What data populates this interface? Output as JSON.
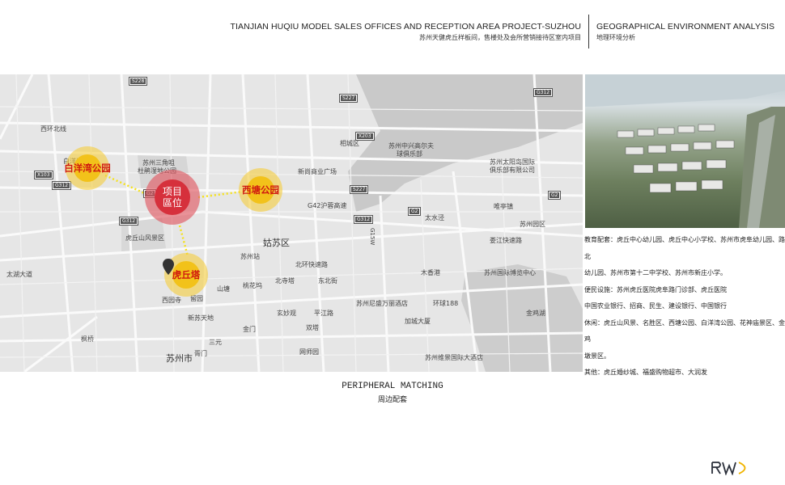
{
  "header": {
    "title_en": "TIANJIAN HUQIU MODEL SALES OFFICES AND RECEPTION AREA PROJECT-SUZHOU",
    "title_cn": "苏州天健虎丘样板间，售楼处及会所营销接待区室内项目",
    "section_en": "GEOGRAPHICAL ENVIRONMENT ANALYSIS",
    "section_cn": "地理环境分析"
  },
  "map": {
    "markers": {
      "project": "项目\n區位",
      "project_line1": "项目",
      "project_line2": "區位",
      "baiyangwan": "白洋湾公园",
      "xitang": "西塘公园",
      "huqiu_tower": "虎丘塔"
    },
    "labels": [
      "苏州三角咀",
      "杜鹃湿地公园",
      "虎丘山风景区",
      "姑苏区",
      "苏州站",
      "苏州中兴高尔夫",
      "球俱乐部",
      "苏州太阳岛国际",
      "俱乐部有限公司",
      "新尚商业广场",
      "G42沪蓉高速",
      "太水泾",
      "唯亭镇",
      "苏州园区",
      "娄江快速路",
      "苏州国际博览中心",
      "苏州尼盛万丽酒店",
      "环球188",
      "加城大厦",
      "苏州维景国际大酒店",
      "双塔",
      "平江路",
      "北寺塔",
      "网师园",
      "苏州市",
      "留园",
      "西园寺",
      "新苏天地",
      "北环快速路",
      "东北街",
      "木香港",
      "金鸡湖",
      "相城区",
      "山塘",
      "桃花坞",
      "西环北线",
      "太湖大道",
      "枫桥",
      "白洋湾",
      "玄妙观",
      "金门",
      "三元",
      "胥门"
    ],
    "shields": [
      "S228",
      "S227",
      "G312",
      "X203",
      "G2",
      "G312",
      "S227",
      "G312",
      "X103",
      "G312",
      "G2",
      "G2",
      "G15W"
    ],
    "connector_color": "#f5e11a",
    "marker_colors": {
      "project": "#d6303c",
      "park": "#f2c21a",
      "label_red": "#d01a10"
    }
  },
  "info": {
    "lines": [
      "教育配套：虎丘中心幼儿园、虎丘中心小学校、苏州市虎阜幼儿园、路北",
      "幼儿园、苏州市第十二中学校、苏州市新庄小学。",
      "便民设施：苏州虎丘医院虎阜路门诊部、虎丘医院",
      "中国农业银行、招商、民生、建设银行、中国银行",
      "休闲：虎丘山风景、名胜区、西塘公园、白洋湾公园、花神庙景区、金鸡",
      "墩景区。",
      "其他：虎丘婚纱城、福盛购物超市、大润发"
    ]
  },
  "caption": {
    "en": "PERIPHERAL MATCHING",
    "cn": "周边配套"
  },
  "logo": {
    "text": "RWD",
    "colors": {
      "dark": "#2a2f3a",
      "accent": "#f0b400"
    }
  }
}
